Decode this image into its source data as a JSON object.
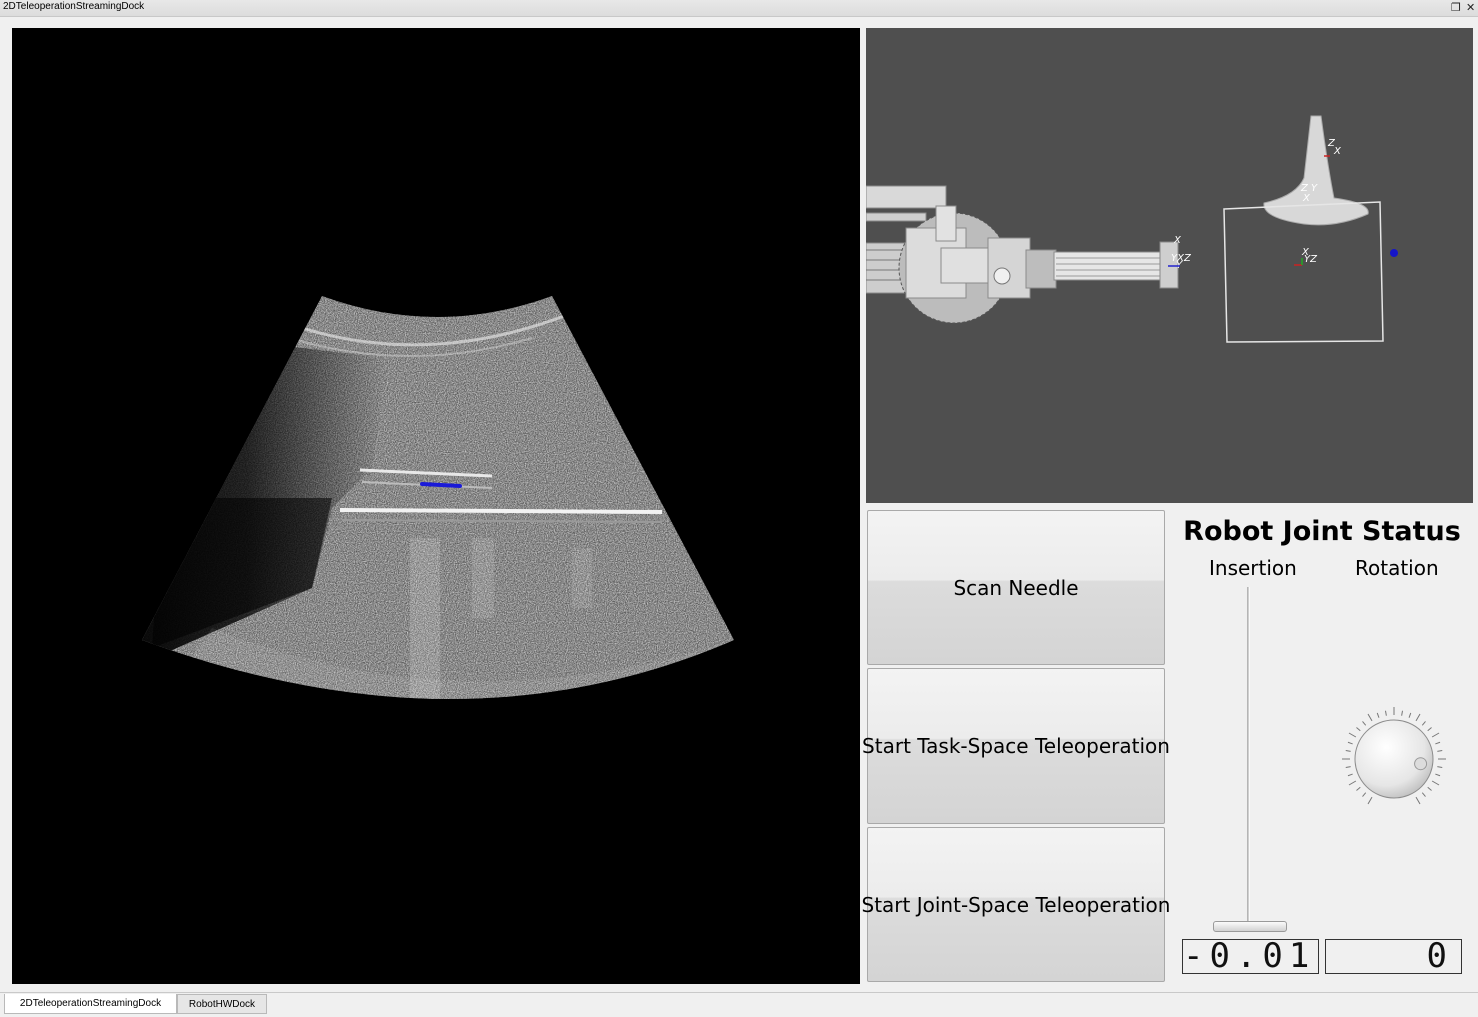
{
  "window": {
    "title": "2DTeleoperationStreamingDock",
    "restore_glyph": "❐",
    "close_glyph": "✕"
  },
  "buttons": {
    "scan_needle": "Scan Needle",
    "task_space": "Start Task-Space Teleoperation",
    "joint_space": "Start Joint-Space Teleoperation"
  },
  "joint_status": {
    "title": "Robot Joint Status",
    "insertion_label": "Insertion",
    "rotation_label": "Rotation",
    "insertion_value": "-0.01",
    "rotation_value": "0",
    "insertion_slider_fraction": 0.0,
    "rotation_dial_degrees": 80
  },
  "scene": {
    "axis_labels": [
      "Z",
      "X",
      "Z Y",
      "X",
      "X",
      "YXZ",
      "Y",
      "X",
      "YZ"
    ]
  },
  "tabs": [
    {
      "label": "2DTeleoperationStreamingDock",
      "active": true
    },
    {
      "label": "RobotHWDock",
      "active": false
    }
  ]
}
